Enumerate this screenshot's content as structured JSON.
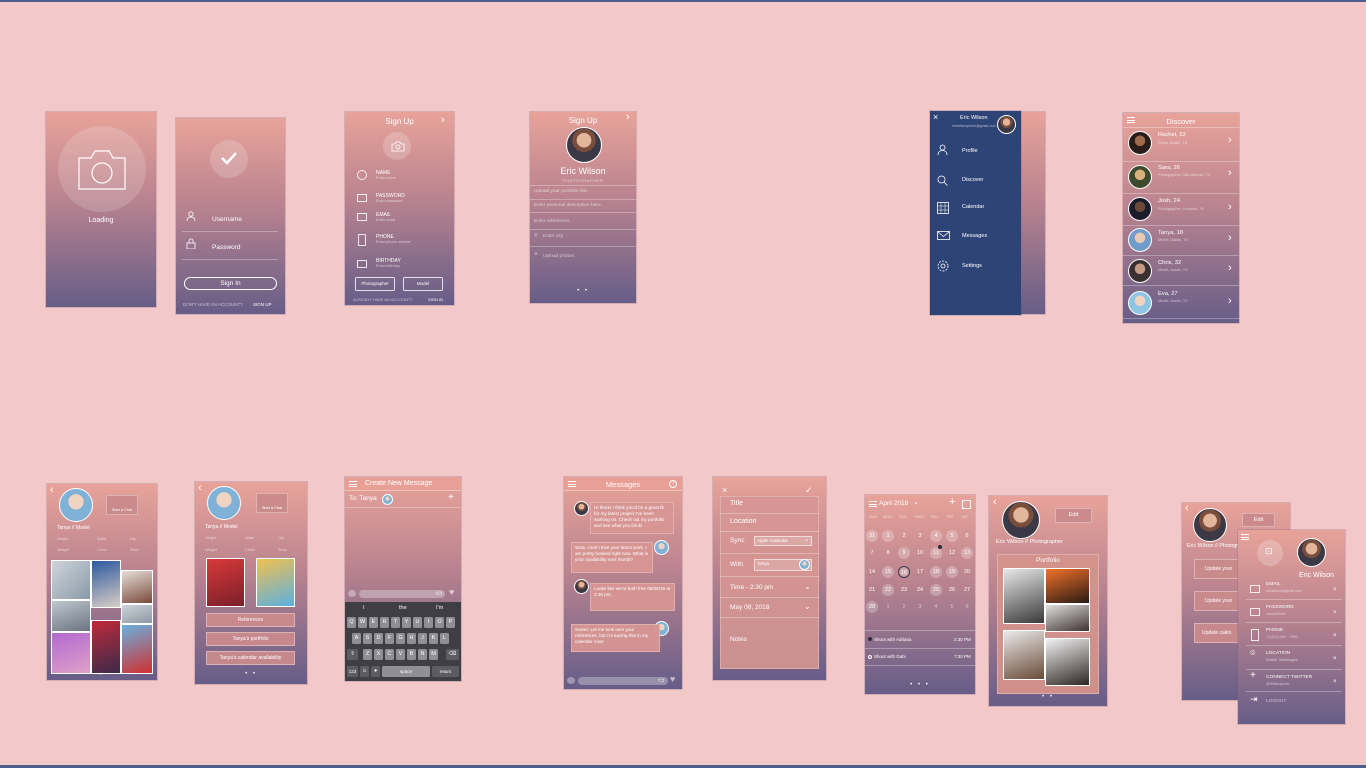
{
  "loading": {
    "label": "Loading"
  },
  "login": {
    "username": "Username",
    "password": "Password",
    "signin": "Sign In",
    "no_account": "DON'T HAVE AN ACCOUNT?",
    "signup": "SIGN UP"
  },
  "signup1": {
    "title": "Sign Up",
    "fields": [
      {
        "label": "NAME",
        "hint": "Enter name"
      },
      {
        "label": "PASSWORD",
        "hint": "Enter password"
      },
      {
        "label": "EMAIL",
        "hint": "Enter email"
      },
      {
        "label": "PHONE",
        "hint": "Enter phone number"
      },
      {
        "label": "BIRTHDAY",
        "hint": "Enter birthday"
      }
    ],
    "btn_photographer": "Photographer",
    "btn_model": "Model",
    "already": "ALREADY HAVE AN ACCOUNT?",
    "signin": "SIGN IN"
  },
  "signup2": {
    "title": "Sign Up",
    "name": "Eric Wilson",
    "role": "PHOTOGRAPHER",
    "fields": [
      "Upload your portfolio link.",
      "Enter personal description here.",
      "Enter references.",
      "Enter city",
      "Upload photos."
    ]
  },
  "menu": {
    "name": "Eric Wilson",
    "email": "ericwilsonphoto@gmail.com",
    "items": [
      "Profile",
      "Discover",
      "Calendar",
      "Messages",
      "Settings"
    ]
  },
  "discover": {
    "title": "Discover",
    "people": [
      {
        "name": "Rachel, 22",
        "sub": "Photo, Austin, TX"
      },
      {
        "name": "Sara, 26",
        "sub": "Photographer, San Antonio, TX"
      },
      {
        "name": "Josh, 24",
        "sub": "Photographer, Houston, TX"
      },
      {
        "name": "Tanya, 18",
        "sub": "Model, Dallas, TX"
      },
      {
        "name": "Chris, 32",
        "sub": "Model, Austin, TX"
      },
      {
        "name": "Eva, 27",
        "sub": "Model, Austin, TX"
      }
    ]
  },
  "profile_tanya": {
    "title": "Tanya // Model",
    "start_chat": "Start a Chat",
    "stats": [
      "Height",
      "Waist",
      "Hip",
      "Weight",
      "Chest",
      "Shoe"
    ],
    "buttons": [
      "References",
      "Tanya's portfolio",
      "Tanya's calendar availability"
    ]
  },
  "newmsg": {
    "title": "Create New Message",
    "to": "To: Tanya",
    "suggest": [
      "I",
      "the",
      "I'm"
    ],
    "row1": [
      "Q",
      "W",
      "E",
      "R",
      "T",
      "Y",
      "U",
      "I",
      "O",
      "P"
    ],
    "row2": [
      "A",
      "S",
      "D",
      "F",
      "G",
      "H",
      "J",
      "K",
      "L"
    ],
    "row3": [
      "Z",
      "X",
      "C",
      "V",
      "B",
      "N",
      "M"
    ],
    "k123": "123",
    "space": "space",
    "return": "return"
  },
  "messages": {
    "title": "Messages",
    "bubbles": [
      "Hi there! I think you'd be a great fit for my latest project I've been working on. Check out my portfolio and see what you think!",
      "Wow, cool! I love your latest work. I am pretty booked right now. What is your availability next month?",
      "Looks like we're both free 05/08/18 at 2:30 pm.",
      "Sweet. Let me look over your references, but I'm saving this in my calendar now!"
    ]
  },
  "event": {
    "fields": [
      "Title",
      "Location"
    ],
    "sync_label": "Sync",
    "sync_value": "Apple Calendar",
    "with_label": "With",
    "with_value": "Tanya",
    "time": "Time - 2:30 pm",
    "date": "May 08, 2018",
    "notes": "Notes"
  },
  "calendar": {
    "month": "April 2018",
    "days": [
      "SUN",
      "MON",
      "TUE",
      "WED",
      "THU",
      "FRI",
      "SAT"
    ],
    "weeks": [
      [
        "31",
        "1",
        "2",
        "3",
        "4",
        "5",
        "6"
      ],
      [
        "7",
        "8",
        "9",
        "10",
        "11",
        "12",
        "13"
      ],
      [
        "14",
        "15",
        "16",
        "17",
        "18",
        "19",
        "20"
      ],
      [
        "21",
        "22",
        "23",
        "24",
        "25",
        "26",
        "27"
      ],
      [
        "28",
        "1",
        "2",
        "3",
        "4",
        "5",
        "6"
      ]
    ],
    "events": [
      {
        "name": "Shoot with Adriana",
        "time": "2:30 PM"
      },
      {
        "name": "Shoot with Gabi",
        "time": "7:30 PM"
      }
    ]
  },
  "profile_eric": {
    "title": "Eric Wilson // Photographer",
    "edit": "Edit",
    "portfolio": "Portfolio"
  },
  "settings": {
    "edit": "Edit",
    "name": "Eric Wilson",
    "subtitle": "Eric Wilson // Photographer",
    "update_btns": [
      "Update your",
      "Update your",
      "Update calen"
    ],
    "items": [
      {
        "label": "EMAIL",
        "value": "ericwilson@gmail.com"
      },
      {
        "label": "PASSWORD",
        "value": "mimusl2018"
      },
      {
        "label": "PHONE",
        "value": "+1 (512) 867 - 7890"
      },
      {
        "label": "LOCATION",
        "value": "Seattle, Washington"
      },
      {
        "label": "CONNECT TWITTER",
        "value": "@Wilsonphoto"
      },
      {
        "label": "LOGOUT",
        "value": ""
      }
    ]
  }
}
